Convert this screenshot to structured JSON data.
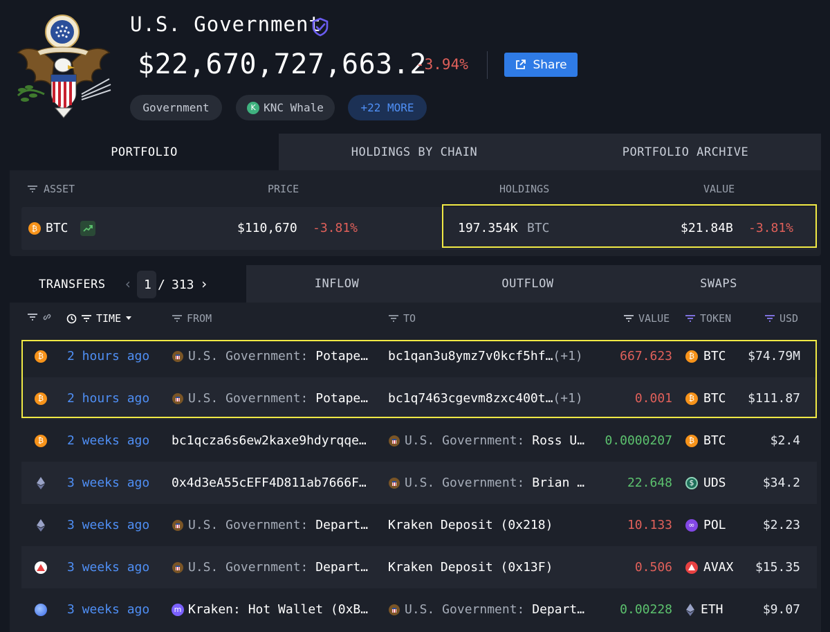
{
  "header": {
    "name": "U.S. Government",
    "total_value": "$22,670,727,663.2",
    "total_change": "-3.94%",
    "share_label": "Share",
    "tags": [
      {
        "label": "Government"
      },
      {
        "label": "KNC Whale"
      },
      {
        "label": "+22 MORE"
      }
    ]
  },
  "portfolio": {
    "tabs": [
      "PORTFOLIO",
      "HOLDINGS BY CHAIN",
      "PORTFOLIO ARCHIVE"
    ],
    "columns": {
      "asset": "ASSET",
      "price": "PRICE",
      "holdings": "HOLDINGS",
      "value": "VALUE"
    },
    "row": {
      "asset": "BTC",
      "price": "$110,670",
      "price_change": "-3.81%",
      "holdings": "197.354K",
      "holdings_unit": "BTC",
      "value": "$21.84B",
      "value_change": "-3.81%"
    }
  },
  "transfers": {
    "tab_label": "TRANSFERS",
    "page_current": "1",
    "page_separator": "/",
    "page_total": "313",
    "tabs": [
      "INFLOW",
      "OUTFLOW",
      "SWAPS"
    ],
    "columns": {
      "time": "TIME",
      "from": "FROM",
      "to": "TO",
      "value": "VALUE",
      "token": "TOKEN",
      "usd": "USD"
    },
    "rows": [
      {
        "chain": "bitcoin",
        "time": "2 hours ago",
        "from_prefix": "U.S. Government:",
        "from_name": "Potape…",
        "to": "bc1qan3u8ymz7v0kcf5hf…",
        "to_extra": "(+1)",
        "value": "667.623",
        "token": "BTC",
        "usd": "$74.79M"
      },
      {
        "chain": "bitcoin",
        "time": "2 hours ago",
        "from_prefix": "U.S. Government:",
        "from_name": "Potape…",
        "to": "bc1q7463cgevm8zxc400t…",
        "to_extra": "(+1)",
        "value": "0.001",
        "token": "BTC",
        "usd": "$111.87"
      },
      {
        "chain": "bitcoin",
        "time": "2 weeks ago",
        "from": "bc1qcza6s6ew2kaxe9hdyrqqe…",
        "to_prefix": "U.S. Government:",
        "to_name": "Ross U…",
        "value": "0.0000207",
        "token": "BTC",
        "usd": "$2.4"
      },
      {
        "chain": "ethereum",
        "time": "3 weeks ago",
        "from": "0x4d3eA55cEFF4D811ab7666F…",
        "to_prefix": "U.S. Government:",
        "to_name": "Brian …",
        "value": "22.648",
        "token": "UDS",
        "usd": "$34.2"
      },
      {
        "chain": "ethereum",
        "time": "3 weeks ago",
        "from_prefix": "U.S. Government:",
        "from_name": "Depart…",
        "to": "Kraken Deposit (0x218)",
        "value": "10.133",
        "token": "POL",
        "usd": "$2.23"
      },
      {
        "chain": "avalanche",
        "time": "3 weeks ago",
        "from_prefix": "U.S. Government:",
        "from_name": "Depart…",
        "to": "Kraken Deposit (0x13F)",
        "value": "0.506",
        "token": "AVAX",
        "usd": "$15.35"
      },
      {
        "chain": "base",
        "time": "3 weeks ago",
        "from": "Kraken: Hot Wallet (0xB…",
        "to_prefix": "U.S. Government:",
        "to_name": "Depart…",
        "value": "0.00228",
        "token": "ETH",
        "usd": "$9.07"
      }
    ]
  },
  "colors": {
    "background": "#141821",
    "accent_blue": "#2f7be6",
    "negative": "#e0605a",
    "positive": "#5cc26e",
    "highlight": "#f1ea45"
  }
}
